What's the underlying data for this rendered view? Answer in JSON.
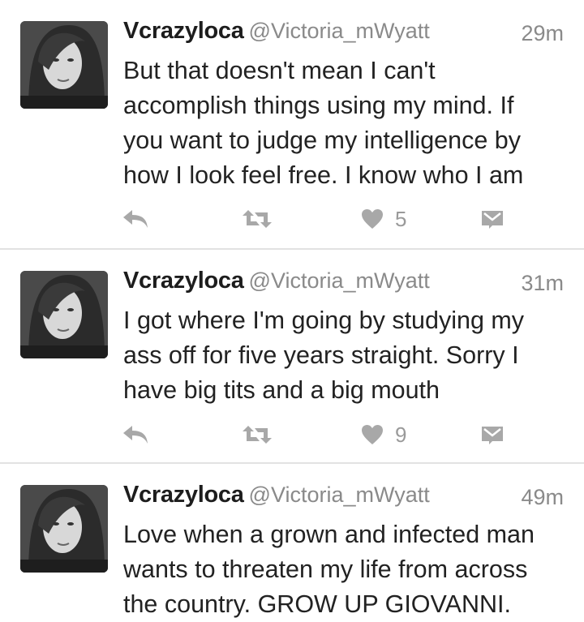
{
  "tweets": [
    {
      "name": "Vcrazyloca",
      "handle": "@Victoria_mWyatt",
      "time": "29m",
      "lines": [
        "But that doesn't mean I can't",
        "accomplish things using my mind. If",
        "you want to judge my intelligence by",
        "how I look feel free. I know who I am"
      ],
      "likes": "5"
    },
    {
      "name": "Vcrazyloca",
      "handle": "@Victoria_mWyatt",
      "time": "31m",
      "lines": [
        "I got where I'm going by studying my",
        "ass off for five years straight. Sorry I",
        "have big tits and a big mouth"
      ],
      "likes": "9"
    },
    {
      "name": "Vcrazyloca",
      "handle": "@Victoria_mWyatt",
      "time": "49m",
      "lines": [
        "Love when a grown and infected man",
        "wants to threaten my life from across",
        "the country. GROW UP GIOVANNI."
      ]
    }
  ],
  "icons": {
    "reply": "reply-icon",
    "retweet": "retweet-icon",
    "like": "heart-icon",
    "message": "direct-message-icon"
  },
  "colors": {
    "icon": "#a8a8a8",
    "text": "#222222",
    "muted": "#8a8a8a"
  }
}
